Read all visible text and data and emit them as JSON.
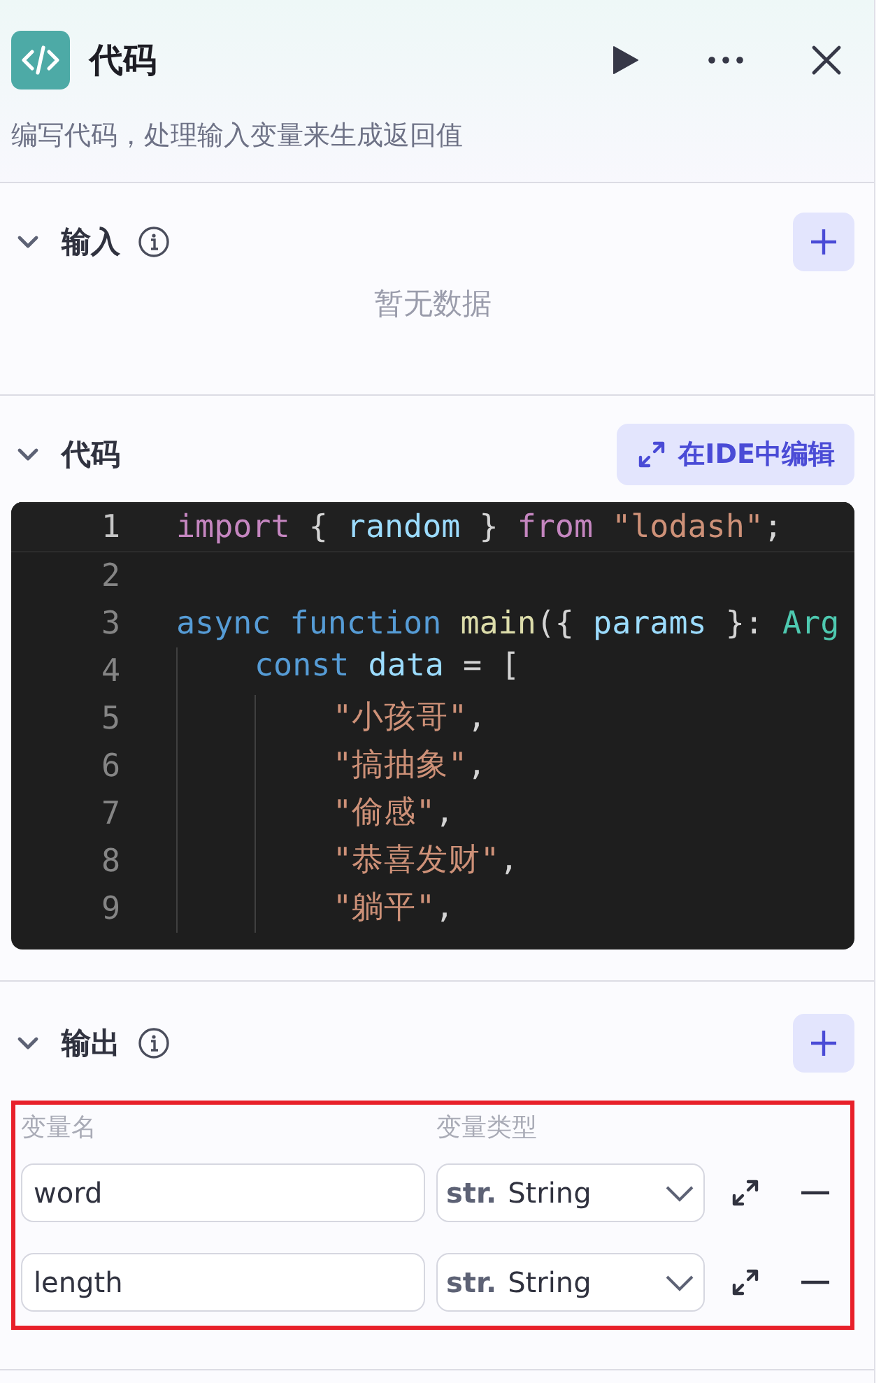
{
  "header": {
    "title": "代码",
    "description": "编写代码，处理输入变量来生成返回值"
  },
  "input_section": {
    "title": "输入",
    "expanded": true,
    "empty_text": "暂无数据"
  },
  "code_section": {
    "title": "代码",
    "expanded": true,
    "ide_button": "在IDE中编辑",
    "lines": [
      {
        "number": "1",
        "tokens": [
          {
            "kind": "keyword2",
            "text": "import"
          },
          {
            "kind": "punct",
            "text": " { "
          },
          {
            "kind": "variable",
            "text": "random"
          },
          {
            "kind": "punct",
            "text": " } "
          },
          {
            "kind": "keyword2",
            "text": "from "
          },
          {
            "kind": "string",
            "text": "\"lodash\""
          },
          {
            "kind": "punct",
            "text": ";"
          }
        ]
      },
      {
        "number": "2"
      },
      {
        "number": "3",
        "tokens": [
          {
            "kind": "keyword",
            "text": "async "
          },
          {
            "kind": "keyword",
            "text": "function "
          },
          {
            "kind": "function",
            "text": "main"
          },
          {
            "kind": "punct",
            "text": "({ "
          },
          {
            "kind": "param",
            "text": "params"
          },
          {
            "kind": "punct",
            "text": " }: "
          },
          {
            "kind": "type",
            "text": "Arg"
          }
        ],
        "children": [
          {
            "number": "4",
            "tokens": [
              {
                "kind": "keyword",
                "text": "const "
              },
              {
                "kind": "variable",
                "text": "data"
              },
              {
                "kind": "punct",
                "text": " = ["
              }
            ],
            "children": [
              {
                "number": "5",
                "tokens": [
                  {
                    "kind": "string",
                    "text": "\"小孩哥\""
                  },
                  {
                    "kind": "punct",
                    "text": ","
                  }
                ]
              },
              {
                "number": "6",
                "tokens": [
                  {
                    "kind": "string",
                    "text": "\"搞抽象\""
                  },
                  {
                    "kind": "punct",
                    "text": ","
                  }
                ]
              },
              {
                "number": "7",
                "tokens": [
                  {
                    "kind": "string",
                    "text": "\"偷感\""
                  },
                  {
                    "kind": "punct",
                    "text": ","
                  }
                ]
              },
              {
                "number": "8",
                "tokens": [
                  {
                    "kind": "string",
                    "text": "\"恭喜发财\""
                  },
                  {
                    "kind": "punct",
                    "text": ","
                  }
                ]
              },
              {
                "number": "9",
                "tokens": [
                  {
                    "kind": "string",
                    "text": "\"躺平\""
                  },
                  {
                    "kind": "punct",
                    "text": ","
                  }
                ]
              }
            ]
          }
        ]
      }
    ]
  },
  "output_section": {
    "title": "输出",
    "expanded": true,
    "columns": [
      "变量名",
      "变量类型"
    ],
    "highlighted": true,
    "rows": [
      {
        "name": "word",
        "type_prefix": "str.",
        "type": "String"
      },
      {
        "name": "length",
        "type_prefix": "str.",
        "type": "String"
      }
    ]
  }
}
